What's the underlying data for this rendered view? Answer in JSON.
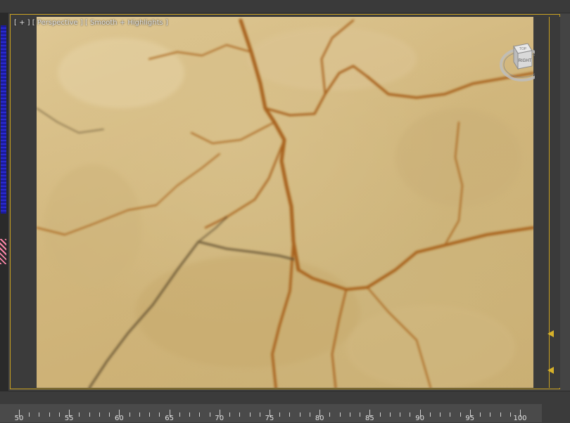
{
  "viewport": {
    "label": "[ + ] [ Perspective ] [ Smooth + Highlights ]",
    "viewcube_face": "RIGHT",
    "viewcube_top": "TOP",
    "border_color": "#c8a020"
  },
  "timeline": {
    "labels": [
      "50",
      "55",
      "60",
      "65",
      "70",
      "75",
      "80",
      "85",
      "90",
      "95",
      "100"
    ]
  },
  "colors": {
    "background": "#444444",
    "accent": "#c8a020",
    "surface": "#d4bb82",
    "crack": "#a8621c"
  }
}
